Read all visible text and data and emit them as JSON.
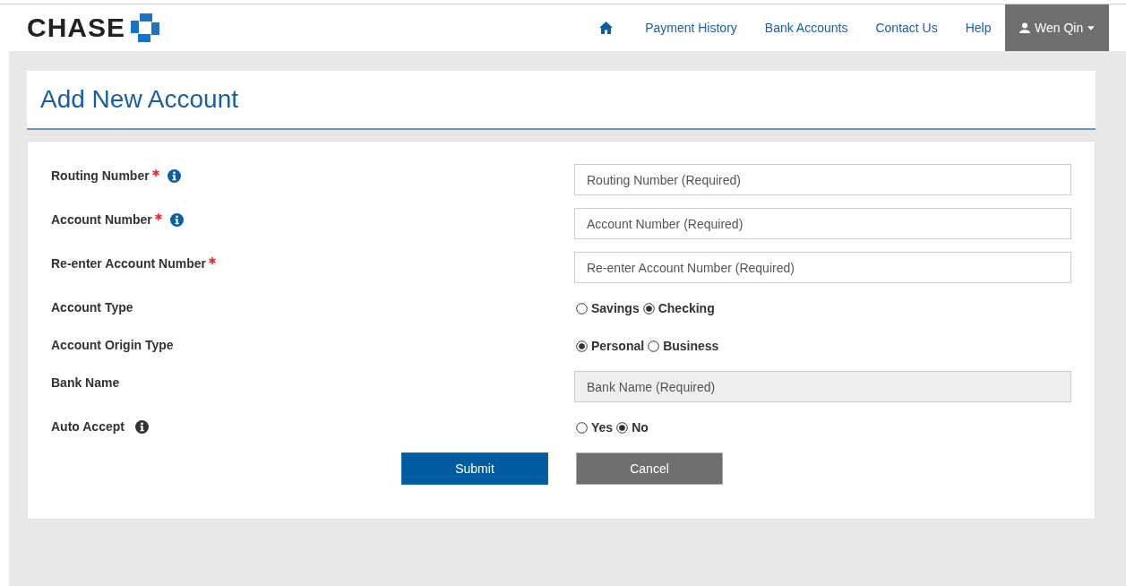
{
  "header": {
    "logo": "CHASE",
    "nav": [
      {
        "kind": "home"
      },
      {
        "kind": "link",
        "label": "Payment History"
      },
      {
        "kind": "link",
        "label": "Bank Accounts"
      },
      {
        "kind": "link",
        "label": "Contact Us"
      },
      {
        "kind": "link",
        "label": "Help"
      }
    ],
    "user": {
      "name": "Wen Qin"
    }
  },
  "page_title": "Add New Account",
  "fields": [
    {
      "kind": "text",
      "label": "Routing Number",
      "required": true,
      "info": true,
      "placeholder": "Routing Number (Required)",
      "disabled": false
    },
    {
      "kind": "text",
      "label": "Account Number",
      "required": true,
      "info": true,
      "placeholder": "Account Number (Required)",
      "disabled": false
    },
    {
      "kind": "text",
      "label": "Re-enter Account Number",
      "required": true,
      "info": false,
      "placeholder": "Re-enter Account Number (Required)",
      "disabled": false
    },
    {
      "kind": "radio",
      "label": "Account Type",
      "required": false,
      "info": false,
      "options": [
        {
          "label": "Savings",
          "selected": false
        },
        {
          "label": "Checking",
          "selected": true
        }
      ]
    },
    {
      "kind": "radio",
      "label": "Account Origin Type",
      "required": false,
      "info": false,
      "options": [
        {
          "label": "Personal",
          "selected": true
        },
        {
          "label": "Business",
          "selected": false
        }
      ]
    },
    {
      "kind": "text",
      "label": "Bank Name",
      "required": false,
      "info": false,
      "placeholder": "Bank Name (Required)",
      "disabled": true
    },
    {
      "kind": "radio",
      "label": "Auto Accept",
      "required": false,
      "info": true,
      "options": [
        {
          "label": "Yes",
          "selected": false
        },
        {
          "label": "No",
          "selected": true
        }
      ]
    }
  ],
  "buttons": [
    {
      "kind": "primary",
      "label": "Submit"
    },
    {
      "kind": "secondary",
      "label": "Cancel"
    }
  ]
}
